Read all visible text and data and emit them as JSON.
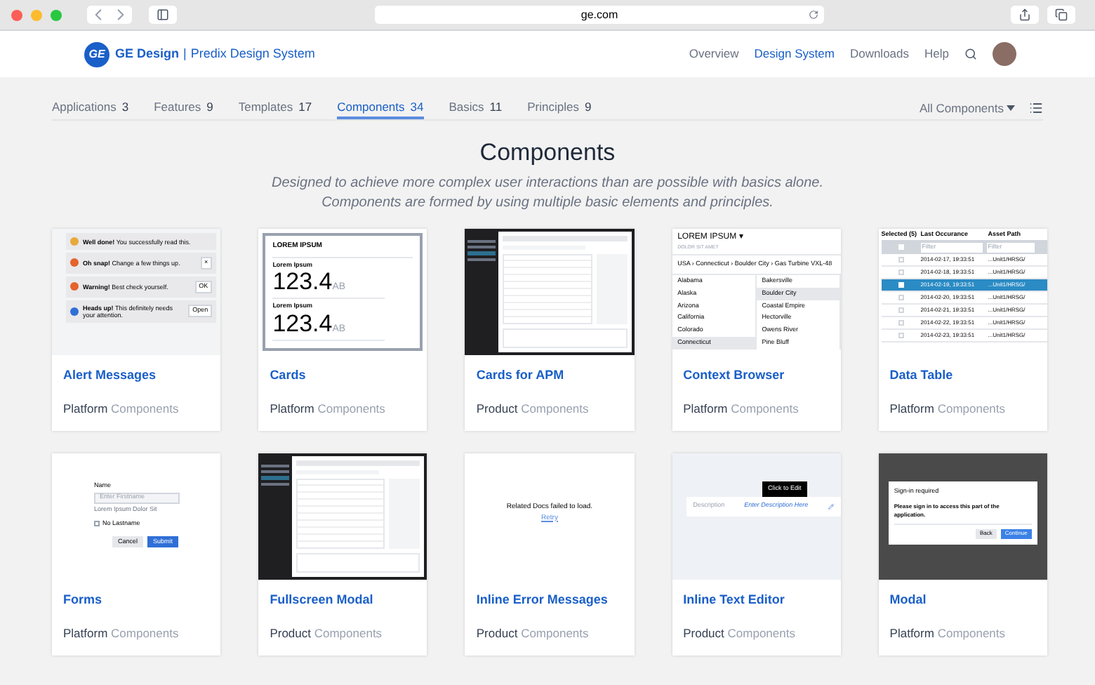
{
  "browser": {
    "url": "ge.com"
  },
  "header": {
    "logo": "GE",
    "brand": "GE Design",
    "separator": "|",
    "product": "Predix Design System",
    "nav": [
      {
        "label": "Overview",
        "selected": false
      },
      {
        "label": "Design System",
        "selected": true
      },
      {
        "label": "Downloads",
        "selected": false
      },
      {
        "label": "Help",
        "selected": false
      }
    ]
  },
  "tabs": [
    {
      "label": "Applications",
      "count": "3",
      "selected": false
    },
    {
      "label": "Features",
      "count": "9",
      "selected": false
    },
    {
      "label": "Templates",
      "count": "17",
      "selected": false
    },
    {
      "label": "Components",
      "count": "34",
      "selected": true
    },
    {
      "label": "Basics",
      "count": "11",
      "selected": false
    },
    {
      "label": "Principles",
      "count": "9",
      "selected": false
    }
  ],
  "filter": {
    "label": "All Components"
  },
  "heading": "Components",
  "description": [
    "Designed to achieve more complex user interactions than are possible with basics alone.",
    "Components are formed by using multiple basic elements and principles."
  ],
  "cards": [
    {
      "title": "Alert Messages",
      "category": "Platform",
      "type": "Components",
      "preview": {
        "kind": "alerts",
        "items": [
          {
            "title": "Well done!",
            "text": "You successfully read this.",
            "color": "#e8a93a"
          },
          {
            "title": "Oh snap!",
            "text": "Change a few things up.",
            "color": "#e5622b",
            "action": "×"
          },
          {
            "title": "Warning!",
            "text": "Best check yourself.",
            "color": "#e5622b",
            "action": "OK"
          },
          {
            "title": "Heads up!",
            "text": "This definitely needs your attention.",
            "color": "#2f6fd6",
            "action": "Open"
          }
        ]
      }
    },
    {
      "title": "Cards",
      "category": "Platform",
      "type": "Components",
      "preview": {
        "kind": "cards",
        "header": "LOREM IPSUM",
        "tiles": [
          {
            "label": "Lorem Ipsum",
            "value": "123.4",
            "unit": "AB"
          },
          {
            "label": "Lorem Ipsum",
            "value": "123.4",
            "unit": "AB"
          }
        ]
      }
    },
    {
      "title": "Cards for APM",
      "category": "Product",
      "type": "Components",
      "preview": {
        "kind": "app"
      }
    },
    {
      "title": "Context Browser",
      "category": "Platform",
      "type": "Components",
      "preview": {
        "kind": "browser",
        "title": "LOREM IPSUM ▾",
        "subtitle": "DOLOR SIT AMET",
        "path": "USA › Connecticut › Boulder City › Gas Turbine VXL-48",
        "left": [
          {
            "label": "Alabama",
            "selected": false
          },
          {
            "label": "Alaska",
            "selected": false
          },
          {
            "label": "Arizona",
            "selected": false
          },
          {
            "label": "California",
            "selected": false
          },
          {
            "label": "Colorado",
            "selected": false
          },
          {
            "label": "Connecticut",
            "selected": true
          }
        ],
        "right": [
          {
            "label": "Bakersville",
            "selected": false
          },
          {
            "label": "Boulder City",
            "selected": true
          },
          {
            "label": "Coastal Empire",
            "selected": false
          },
          {
            "label": "Hectorville",
            "selected": false
          },
          {
            "label": "Owens River",
            "selected": false
          },
          {
            "label": "Pine Bluff",
            "selected": false
          }
        ]
      }
    },
    {
      "title": "Data Table",
      "category": "Platform",
      "type": "Components",
      "preview": {
        "kind": "table",
        "columns": [
          "Selected (5)",
          "Last Occurance",
          "Asset Path"
        ],
        "select_all": {
          "checked": false
        },
        "filter_placeholders": [
          "Filter",
          "Filter"
        ],
        "rows": [
          {
            "date": "2014-02-17, 19:33:51",
            "path": "...Unit1/HRSG/",
            "selected": false
          },
          {
            "date": "2014-02-18, 19:33:51",
            "path": "...Unit1/HRSG/",
            "selected": false
          },
          {
            "date": "2014-02-19, 19:33:51",
            "path": "...Unit1/HRSG/",
            "selected": true
          },
          {
            "date": "2014-02-20, 19:33:51",
            "path": "...Unit1/HRSG/",
            "selected": false
          },
          {
            "date": "2014-02-21, 19:33:51",
            "path": "...Unit1/HRSG/",
            "selected": false
          },
          {
            "date": "2014-02-22, 19:33:51",
            "path": "...Unit1/HRSG/",
            "selected": false
          },
          {
            "date": "2014-02-23, 19:33:51",
            "path": "...Unit1/HRSG/",
            "selected": false
          }
        ]
      }
    },
    {
      "title": "Forms",
      "category": "Platform",
      "type": "Components",
      "preview": {
        "kind": "form",
        "label": "Name",
        "placeholder": "Enter Firstname",
        "help": "Lorem Ipsum Dolor Sit",
        "checkbox": {
          "label": "No Lastname",
          "checked": false
        },
        "buttons": [
          "Cancel",
          "Submit"
        ]
      }
    },
    {
      "title": "Fullscreen Modal",
      "category": "Product",
      "type": "Components",
      "preview": {
        "kind": "app"
      }
    },
    {
      "title": "Inline Error Messages",
      "category": "Product",
      "type": "Components",
      "preview": {
        "kind": "error",
        "message": "Related Docs failed to load.",
        "link": "Retry"
      }
    },
    {
      "title": "Inline Text Editor",
      "category": "Product",
      "type": "Components",
      "preview": {
        "kind": "editor",
        "tooltip": "Click to Edit",
        "label": "Description",
        "value": "Enter Description Here"
      }
    },
    {
      "title": "Modal",
      "category": "Platform",
      "type": "Components",
      "preview": {
        "kind": "modal",
        "title": "Sign-in required",
        "body": "Please sign in to access this part of the application.",
        "buttons": [
          "Back",
          "Continue"
        ]
      }
    }
  ]
}
